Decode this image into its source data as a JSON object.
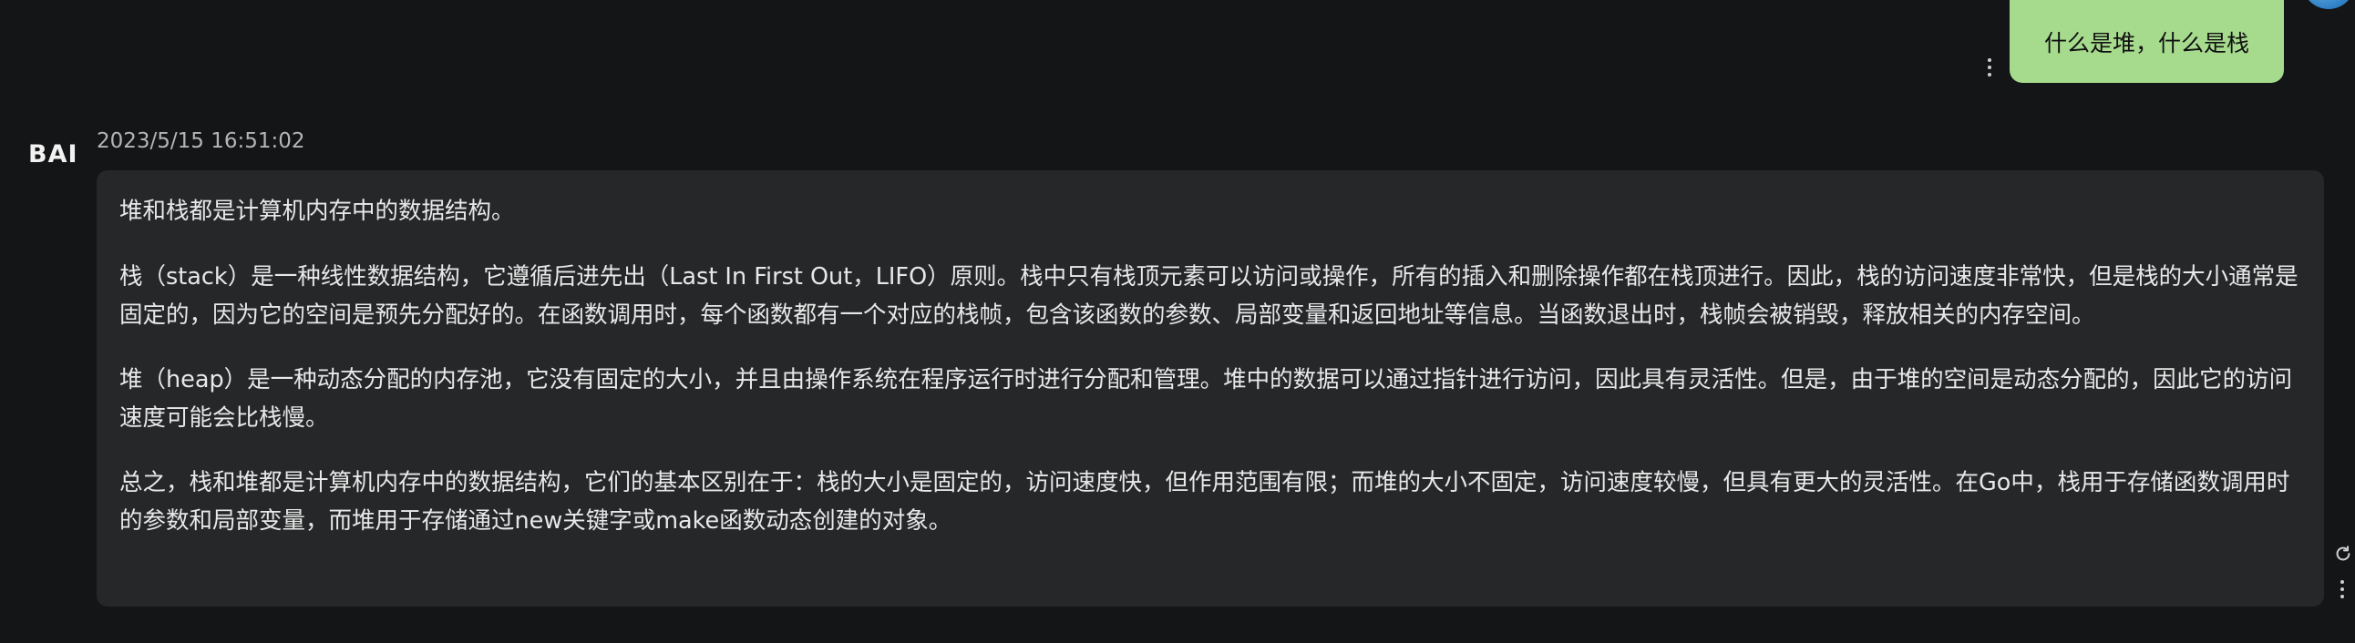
{
  "user_message": {
    "text": "什么是堆，什么是栈"
  },
  "bot": {
    "avatar_label": "BAI",
    "timestamp": "2023/5/15 16:51:02",
    "paragraphs": [
      "堆和栈都是计算机内存中的数据结构。",
      "栈（stack）是一种线性数据结构，它遵循后进先出（Last In First Out，LIFO）原则。栈中只有栈顶元素可以访问或操作，所有的插入和删除操作都在栈顶进行。因此，栈的访问速度非常快，但是栈的大小通常是固定的，因为它的空间是预先分配好的。在函数调用时，每个函数都有一个对应的栈帧，包含该函数的参数、局部变量和返回地址等信息。当函数退出时，栈帧会被销毁，释放相关的内存空间。",
      "堆（heap）是一种动态分配的内存池，它没有固定的大小，并且由操作系统在程序运行时进行分配和管理。堆中的数据可以通过指针进行访问，因此具有灵活性。但是，由于堆的空间是动态分配的，因此它的访问速度可能会比栈慢。",
      "总之，栈和堆都是计算机内存中的数据结构，它们的基本区别在于：栈的大小是固定的，访问速度快，但作用范围有限；而堆的大小不固定，访问速度较慢，但具有更大的灵活性。在Go中，栈用于存储函数调用时的参数和局部变量，而堆用于存储通过new关键字或make函数动态创建的对象。"
    ]
  },
  "icons": {
    "user_menu": "more-vertical-icon",
    "bot_menu": "more-vertical-icon",
    "refresh": "refresh-icon"
  },
  "colors": {
    "background": "#141517",
    "user_bubble": "#a6db8e",
    "answer_card": "#262729"
  }
}
